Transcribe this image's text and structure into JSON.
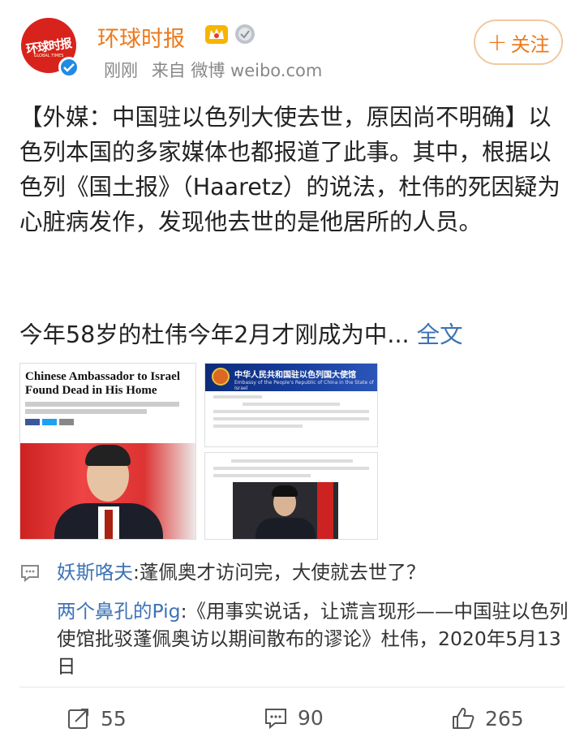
{
  "account": {
    "name": "环球时报",
    "avatar_text": "环球时报",
    "avatar_sub": "GLOBAL TIMES",
    "meta_time": "刚刚",
    "meta_source": "来自 微博 weibo.com"
  },
  "follow_button": {
    "label": "关注"
  },
  "post": {
    "paragraph": "【外媒：中国驻以色列大使去世，原因尚不明确】以色列本国的多家媒体也都报道了此事。其中，根据以色列《国土报》（Haaretz）的说法，杜伟的死因疑为心脏病发作，发现他去世的是他居所的人员。",
    "truncated": "今年58岁的杜伟今年2月才刚成为中...",
    "more_link": "全文"
  },
  "photos": {
    "p1_headline": "Chinese Ambassador to Israel Found Dead in His Home",
    "p2_title": "中华人民共和国驻以色列国大使馆",
    "p2_subtitle": "Embassy of the People's Republic of China in the State of Israel"
  },
  "comments": [
    {
      "user": "妖斯咯夫",
      "text": ":蓬佩奥才访问完，大使就去世了？"
    },
    {
      "user": "两个鼻孔的Pig",
      "text": ":《用事实说话，让谎言现形——中国驻以色列使馆批驳蓬佩奥访以期间散布的谬论》杜伟，2020年5月13日"
    }
  ],
  "actions": {
    "repost": "55",
    "comment": "90",
    "like": "265"
  },
  "colors": {
    "brand": "#ea7a1e",
    "link": "#3d73b5"
  }
}
